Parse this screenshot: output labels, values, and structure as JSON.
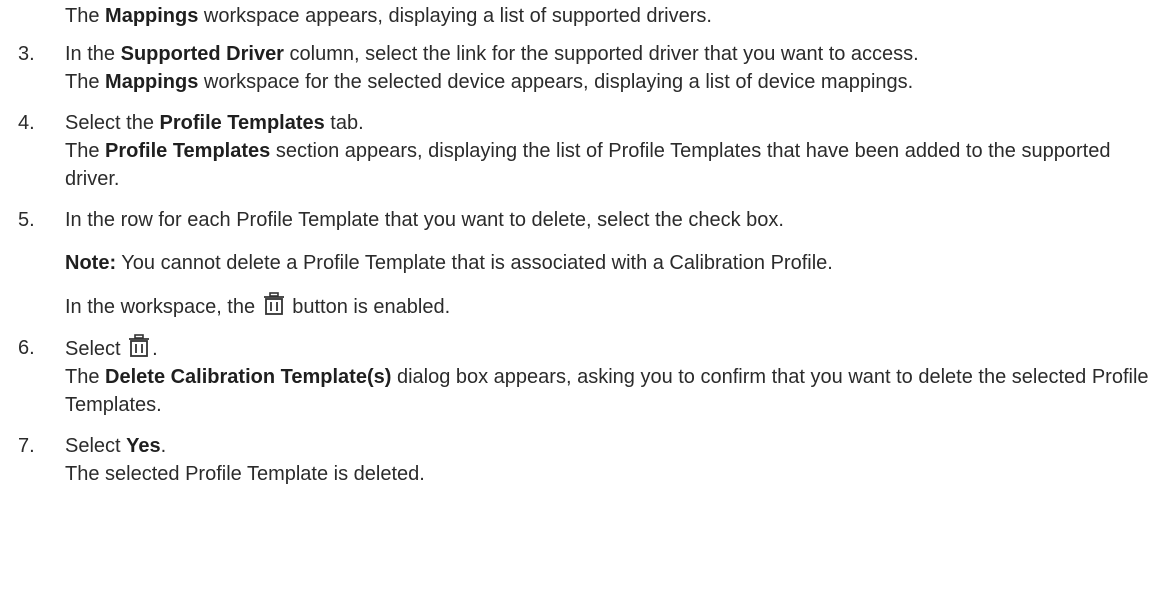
{
  "intro": {
    "pre": "The ",
    "bold": "Mappings",
    "post": " workspace appears, displaying a list of supported drivers."
  },
  "steps": [
    {
      "number": "3",
      "line_pre": "In the ",
      "line_bold": "Supported Driver",
      "line_post": " column, select the link for the supported driver that you want to access.",
      "result_pre": "The ",
      "result_bold": "Mappings",
      "result_post": " workspace for the selected device appears, displaying a list of device mappings."
    },
    {
      "number": "4",
      "line_pre": "Select the ",
      "line_bold": "Profile Templates",
      "line_post": " tab.",
      "result_pre": "The ",
      "result_bold": "Profile Templates",
      "result_post": " section appears, displaying the list of Profile Templates that have been added to the supported driver."
    },
    {
      "number": "5",
      "line": "In the row for each Profile Template that you want to delete, select the check box.",
      "note_label": "Note:",
      "note_text": " You cannot delete a Profile Template that is associated with a Calibration Profile.",
      "enabled_pre": "In the workspace, the ",
      "enabled_post": " button is enabled."
    },
    {
      "number": "6",
      "line_pre": "Select ",
      "line_post": ".",
      "result_pre": "The ",
      "result_bold": "Delete Calibration Template(s)",
      "result_post": " dialog box appears, asking you to confirm that you want to delete the selected Profile Templates."
    },
    {
      "number": "7",
      "line_pre": "Select ",
      "line_bold": "Yes",
      "line_post": ".",
      "result": "The selected Profile Template is deleted."
    }
  ],
  "icons": {
    "delete": "trash-icon"
  }
}
